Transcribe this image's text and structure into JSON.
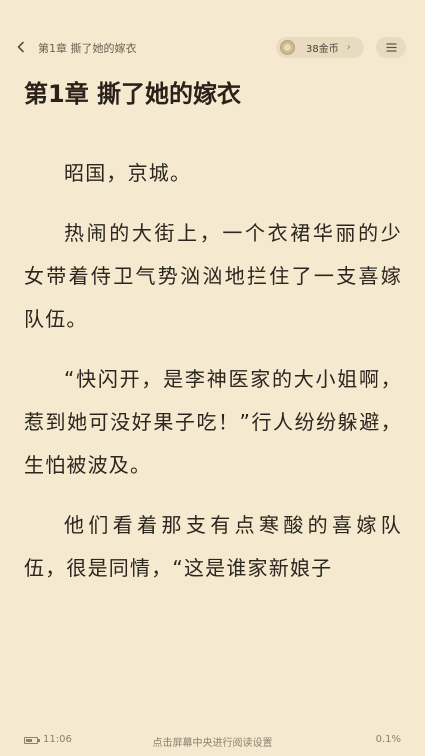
{
  "header": {
    "back_icon": "chevron-left-icon",
    "chapter_title": "第1章  撕了她的嫁衣",
    "coins_label": "38金币",
    "coins_chevron": "›",
    "menu_icon": "hamburger-menu-icon"
  },
  "chapter": {
    "heading": "第1章  撕了她的嫁衣",
    "paragraphs": [
      "昭国，京城。",
      "热闹的大街上，一个衣裙华丽的少女带着侍卫气势汹汹地拦住了一支喜嫁队伍。",
      "“快闪开，是李神医家的大小姐啊，惹到她可没好果子吃！”行人纷纷躲避，生怕被波及。",
      "他们看着那支有点寒酸的喜嫁队伍，很是同情，“这是谁家新娘子"
    ]
  },
  "status": {
    "battery_level": 0.6,
    "time": "11:06",
    "hint": "点击屏幕中央进行阅读设置",
    "progress": "0.1%"
  },
  "colors": {
    "background": "#f5e9cf",
    "text": "#2b261f",
    "muted": "#8a8172"
  }
}
